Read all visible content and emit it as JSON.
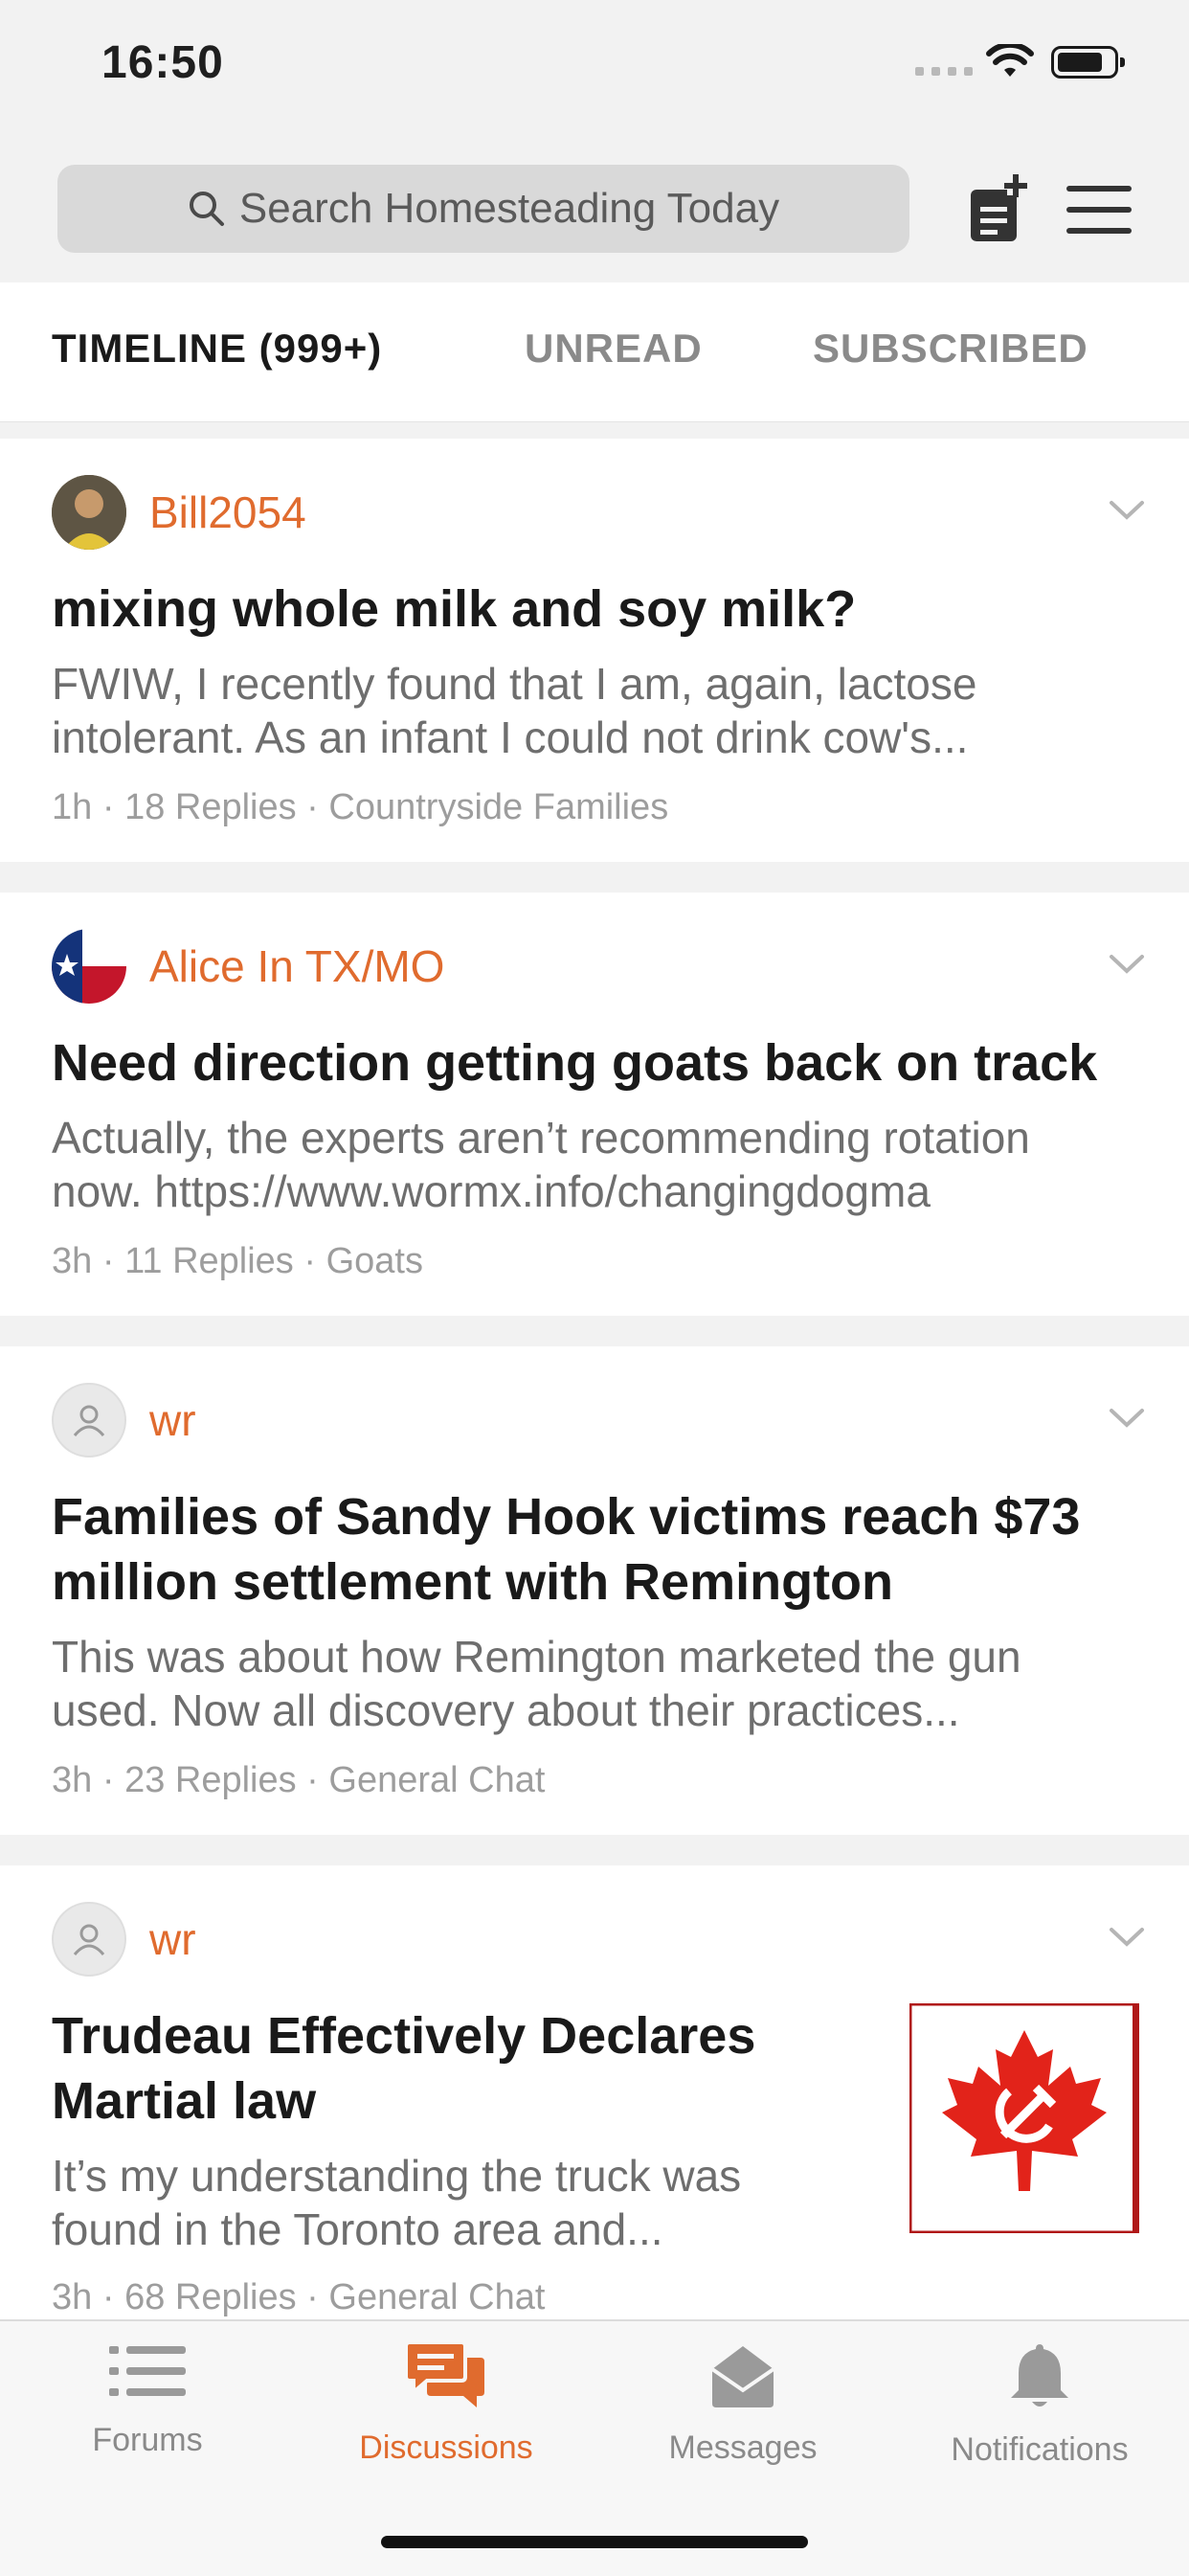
{
  "status": {
    "time": "16:50"
  },
  "header": {
    "search_placeholder": "Search Homesteading Today"
  },
  "tabs": [
    {
      "label": "TIMELINE (999+)",
      "active": true
    },
    {
      "label": "UNREAD",
      "active": false
    },
    {
      "label": "SUBSCRIBED",
      "active": false
    }
  ],
  "posts": [
    {
      "author": "Bill2054",
      "title": "mixing whole milk and soy milk?",
      "excerpt": "FWIW, I recently found that I am, again, lactose intolerant. As an infant I could not drink cow's...",
      "time": "1h",
      "replies": "18 Replies",
      "forum": "Countryside Families"
    },
    {
      "author": "Alice In TX/MO",
      "title": "Need direction getting goats back on track",
      "excerpt": "Actually, the experts aren’t recommending rotation now.  https://www.wormx.info/changingdogma",
      "time": "3h",
      "replies": "11 Replies",
      "forum": "Goats"
    },
    {
      "author": "wr",
      "title": "Families of Sandy Hook victims reach $73 million settlement with Remington",
      "excerpt": "This was about  how Remington  marketed the gun used. Now all discovery  about their  practices...",
      "time": "3h",
      "replies": "23 Replies",
      "forum": "General Chat"
    },
    {
      "author": "wr",
      "title": "Trudeau Effectively Declares Martial law",
      "excerpt": "It’s my understanding the truck was found in the Toronto area and...",
      "time": "3h",
      "replies": "68 Replies",
      "forum": "General Chat"
    }
  ],
  "tabbar": [
    {
      "label": "Forums",
      "icon": "list-icon",
      "active": false
    },
    {
      "label": "Discussions",
      "icon": "chat-bubbles-icon",
      "active": true
    },
    {
      "label": "Messages",
      "icon": "envelope-open-icon",
      "active": false
    },
    {
      "label": "Notifications",
      "icon": "bell-icon",
      "active": false
    }
  ],
  "colors": {
    "accent": "#e06b2e",
    "background": "#f2f2f2",
    "meta": "#9d9d9d"
  }
}
